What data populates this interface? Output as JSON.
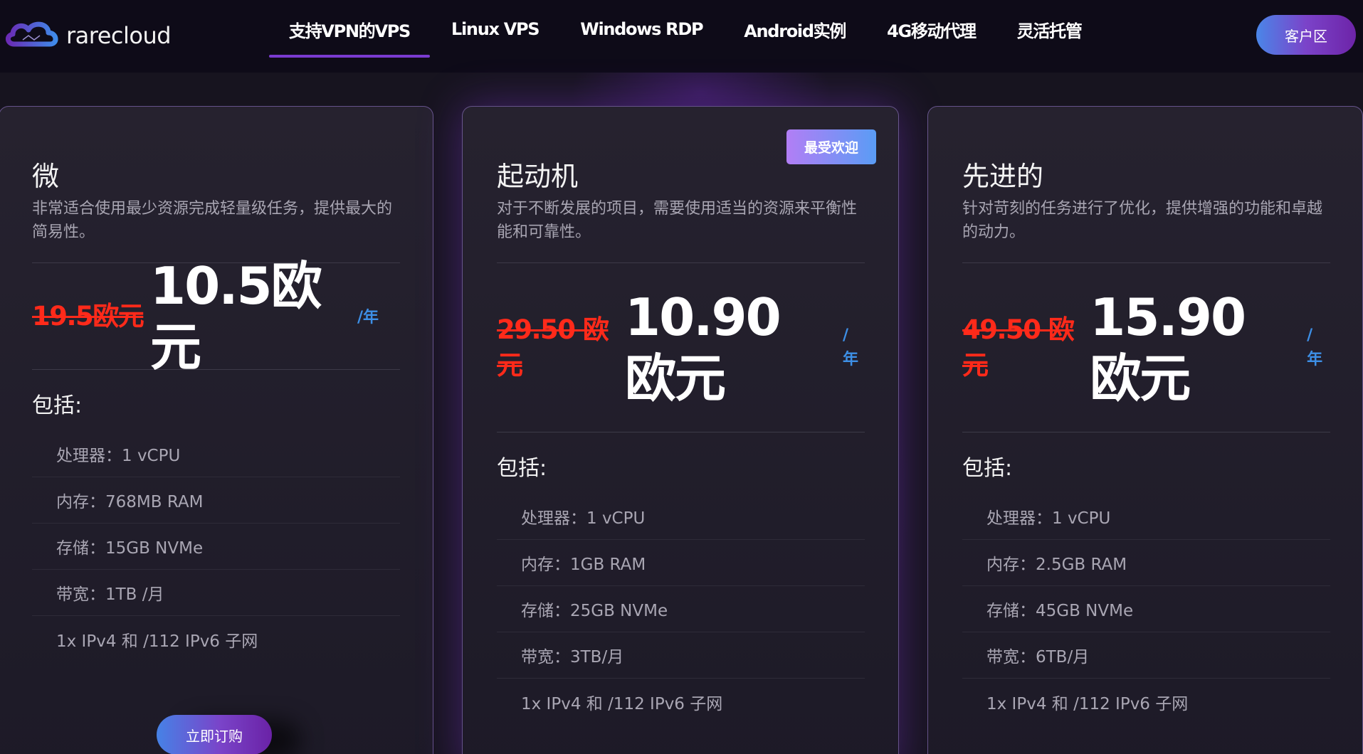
{
  "header": {
    "logo_text": "rarecloud",
    "nav": [
      {
        "label": "支持VPN的VPS",
        "active": true
      },
      {
        "label": "Linux VPS",
        "active": false
      },
      {
        "label": "Windows RDP",
        "active": false
      },
      {
        "label": "Android实例",
        "active": false
      },
      {
        "label": "4G移动代理",
        "active": false
      },
      {
        "label": "灵活托管",
        "active": false
      }
    ],
    "client_area": "客户区"
  },
  "plans": [
    {
      "name": "微",
      "desc": "非常适合使用最少资源完成轻量级任务，提供最大的简易性。",
      "old_price": "19.5欧元",
      "new_price": "10.5欧元",
      "per": "/年",
      "includes": "包括:",
      "features": [
        "处理器：1 vCPU",
        "内存：768MB RAM",
        "存储：15GB NVMe",
        "带宽：1TB /月",
        "1x IPv4 和 /112 IPv6 子网"
      ],
      "order": "立即订购"
    },
    {
      "name": "起动机",
      "badge": "最受欢迎",
      "desc": "对于不断发展的项目，需要使用适当的资源来平衡性能和可靠性。",
      "old_price": "29.50 欧元",
      "new_price": "10.90 欧元",
      "per": "/年",
      "includes": "包括:",
      "features": [
        "处理器：1 vCPU",
        "内存：1GB RAM",
        "存储：25GB NVMe",
        "带宽：3TB/月",
        "1x IPv4 和 /112 IPv6 子网"
      ]
    },
    {
      "name": "先进的",
      "desc": "针对苛刻的任务进行了优化，提供增强的功能和卓越的动力。",
      "old_price": "49.50 欧元",
      "new_price": "15.90 欧元",
      "per": "/年",
      "includes": "包括:",
      "features": [
        "处理器：1 vCPU",
        "内存：2.5GB RAM",
        "存储：45GB NVMe",
        "带宽：6TB/月",
        "1x IPv4 和 /112 IPv6 子网"
      ]
    }
  ]
}
